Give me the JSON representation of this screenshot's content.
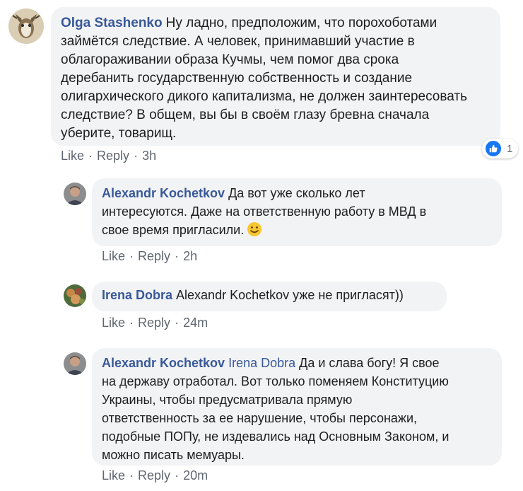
{
  "colors": {
    "author": "#385898",
    "bubble_bg": "#f2f3f5",
    "meta": "#606770",
    "like_blue": "#1877f2"
  },
  "comments": [
    {
      "author": "Olga Stashenko",
      "mention": "",
      "lines": [
        "Ну ладно, предположим, что порохоботами",
        "займётся следствие. А человек, принимавший участие в",
        "облагораживании образа Кучмы, чем помог два срока",
        "деребанить государственную собственность и создание",
        "олигархического дикого капитализма, не должен заинтересовать",
        "следствие? В общем, вы бы в своём глазу бревна сначала",
        "уберите, товарищ."
      ],
      "like": "Like",
      "reply": "Reply",
      "time": "3h",
      "reaction_icon": "thumbs-up-icon",
      "reaction_count": "1"
    },
    {
      "author": "Alexandr Kochetkov",
      "mention": "",
      "lines": [
        "Да вот уже сколько лет",
        "интересуются. Даже на ответственную работу в МВД в",
        "свое время пригласили."
      ],
      "emoji": "smiley-emoji-icon",
      "like": "Like",
      "reply": "Reply",
      "time": "2h"
    },
    {
      "author": "Irena Dobra",
      "mention": "",
      "lines": [
        "Alexandr Kochetkov уже не пригласят))"
      ],
      "like": "Like",
      "reply": "Reply",
      "time": "24m"
    },
    {
      "author": "Alexandr Kochetkov",
      "mention": "Irena Dobra",
      "lines": [
        "Да и слава богу! Я свое",
        "на державу отработал. Вот только поменяем Конституцию",
        "Украины, чтобы предусматривала прямую",
        "ответственность за ее нарушение, чтобы персонажи,",
        "подобные ПОПу, не издевались над Основным Законом, и",
        "можно писать мемуары."
      ],
      "like": "Like",
      "reply": "Reply",
      "time": "20m"
    }
  ]
}
